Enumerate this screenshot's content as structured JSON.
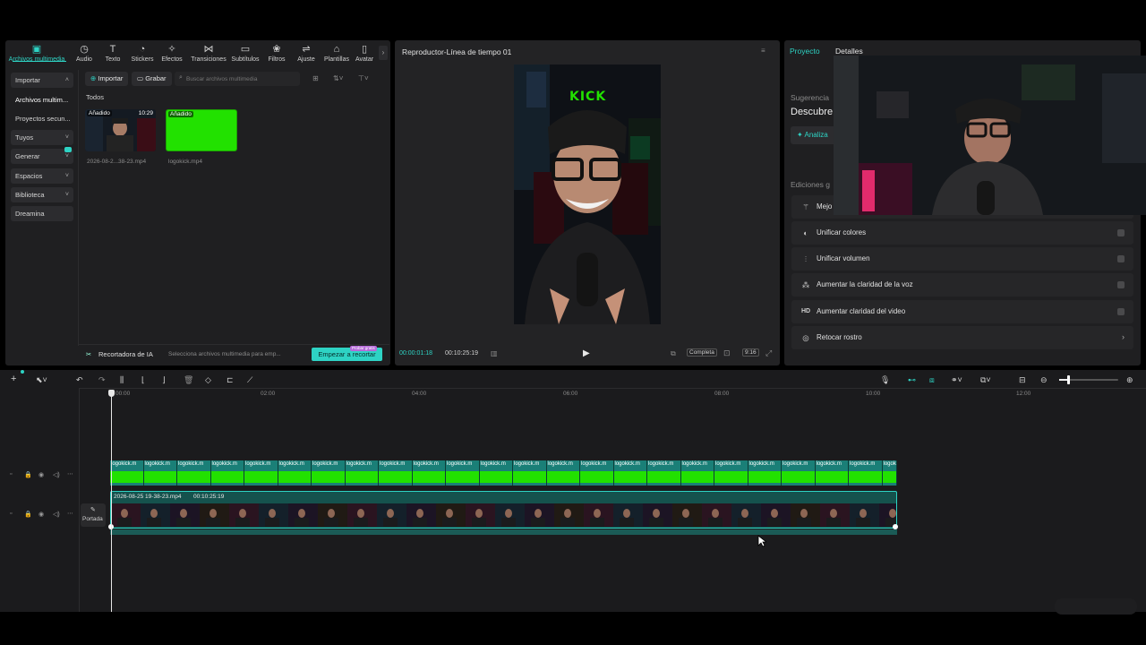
{
  "toolbar": {
    "items": [
      {
        "label": "Archivos multimedia",
        "icon": "media-icon"
      },
      {
        "label": "Audio",
        "icon": "audio-icon"
      },
      {
        "label": "Texto",
        "icon": "text-icon"
      },
      {
        "label": "Stickers",
        "icon": "sticker-icon"
      },
      {
        "label": "Efectos",
        "icon": "effects-icon"
      },
      {
        "label": "Transiciones",
        "icon": "transitions-icon"
      },
      {
        "label": "Subtítulos",
        "icon": "subtitles-icon"
      },
      {
        "label": "Filtros",
        "icon": "filters-icon"
      },
      {
        "label": "Ajuste",
        "icon": "adjust-icon"
      },
      {
        "label": "Plantillas",
        "icon": "templates-icon"
      },
      {
        "label": "Avatar",
        "icon": "avatar-icon"
      }
    ]
  },
  "sidebar": {
    "items": [
      {
        "label": "Importar"
      },
      {
        "label": "Archivos multim..."
      },
      {
        "label": "Proyectos secun..."
      },
      {
        "label": "Tuyos"
      },
      {
        "label": "Generar"
      },
      {
        "label": "Espacios"
      },
      {
        "label": "Biblioteca"
      },
      {
        "label": "Dreamina"
      }
    ]
  },
  "media": {
    "import_label": "Importar",
    "record_label": "Grabar",
    "search_placeholder": "Buscar archivos multimedia",
    "all_label": "Todos",
    "clips": [
      {
        "tag": "Añadido",
        "duration": "10:29",
        "name": "2026-08-2...38-23.mp4"
      },
      {
        "tag": "Añadido",
        "duration": "",
        "name": "logokick.mp4"
      }
    ],
    "ai_label": "Recortadora de IA",
    "ai_hint": "Selecciona archivos multimedia para emp...",
    "ai_button": "Empezar a recortar",
    "ai_badge": "Probar gratis"
  },
  "player": {
    "title": "Reproductor-Línea de tiempo 01",
    "overlay_text": "KICK",
    "current_time": "00:00:01:18",
    "total_time": "00:10:25:19",
    "quality": "Completa",
    "ratio": "9:16"
  },
  "props": {
    "tab_project": "Proyecto",
    "tab_details": "Detalles",
    "suggestion": "Sugerencia",
    "discover": "Descubre",
    "analyze": "Analiza",
    "editions": "Ediciones g",
    "rows": [
      {
        "label": "Mejo",
        "icon": "magic-wand-icon"
      },
      {
        "label": "Unificar colores",
        "icon": "color-icon"
      },
      {
        "label": "Unificar volumen",
        "icon": "volume-sliders-icon"
      },
      {
        "label": "Aumentar la claridad de la voz",
        "icon": "voice-icon"
      },
      {
        "label": "Aumentar claridad del video",
        "icon": "hd-icon"
      },
      {
        "label": "Retocar rostro",
        "icon": "face-retouch-icon"
      }
    ]
  },
  "timeline": {
    "ticks": [
      "00:00",
      "02:00",
      "04:00",
      "06:00",
      "08:00",
      "10:00",
      "12:00"
    ],
    "overlay_clip_label": "logokick.m",
    "overlay_clip_label_last": "logok",
    "main_clip_name": "2026-08-25 19-38-23.mp4",
    "main_clip_duration": "00:10:25:19",
    "cover_label": "Portada"
  },
  "colors": {
    "accent": "#2ed3c4",
    "green_screen": "#22e100",
    "clip_teal": "#1a7f77"
  }
}
